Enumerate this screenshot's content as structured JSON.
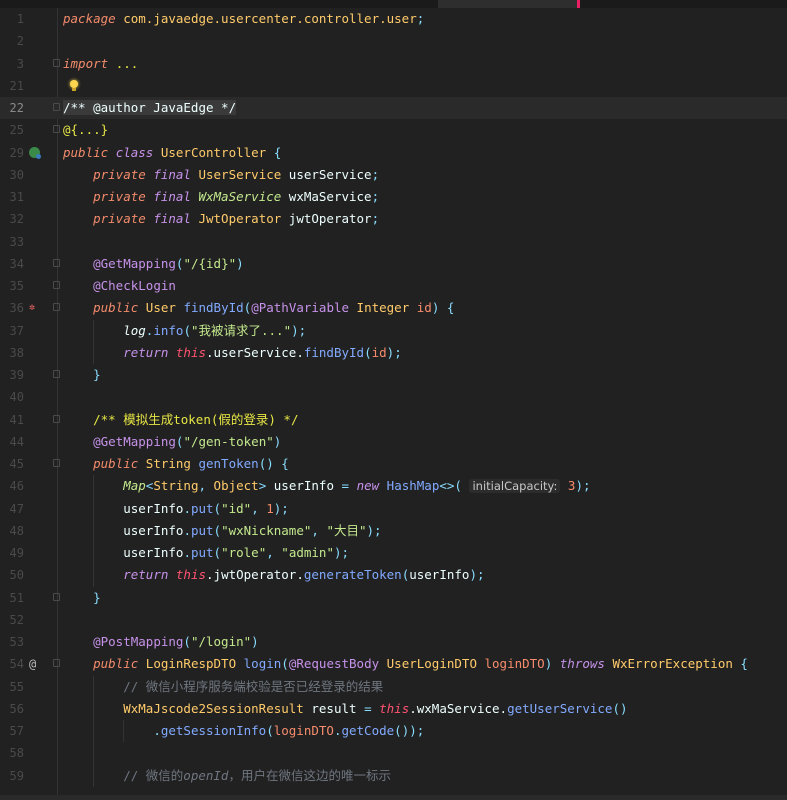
{
  "theme": {
    "background": "#212121",
    "tab_accent": "#e91e63"
  },
  "lines": [
    {
      "n": "1",
      "seg": [
        [
          "package ",
          "kw"
        ],
        [
          "com.javaedge.usercenter.controller.user",
          "ty"
        ],
        [
          ";",
          "pu"
        ]
      ]
    },
    {
      "n": "2",
      "seg": []
    },
    {
      "n": "3",
      "fold": true,
      "seg": [
        [
          "import ",
          "kw"
        ],
        [
          "...",
          "dc"
        ]
      ]
    },
    {
      "n": "21",
      "bulb": true,
      "seg": []
    },
    {
      "n": "22",
      "fold": true,
      "current": true,
      "seg": [
        [
          "/** @author JavaEdge */",
          "dcw"
        ]
      ]
    },
    {
      "n": "25",
      "fold": true,
      "seg": [
        [
          "@{...}",
          "dc"
        ]
      ]
    },
    {
      "n": "29",
      "icon": "class-icon",
      "seg": [
        [
          "public ",
          "kw"
        ],
        [
          "class ",
          "kp"
        ],
        [
          "UserController ",
          "ty"
        ],
        [
          "{",
          "pu"
        ]
      ]
    },
    {
      "n": "30",
      "seg": [
        [
          "    ",
          ""
        ],
        [
          "private ",
          "kw"
        ],
        [
          "final ",
          "kp"
        ],
        [
          "UserService ",
          "ty"
        ],
        [
          "userService",
          "pl"
        ],
        [
          ";",
          "pu"
        ]
      ]
    },
    {
      "n": "31",
      "seg": [
        [
          "    ",
          ""
        ],
        [
          "private ",
          "kw"
        ],
        [
          "final ",
          "kp"
        ],
        [
          "WxMaService ",
          "tyg"
        ],
        [
          "wxMaService",
          "pl"
        ],
        [
          ";",
          "pu"
        ]
      ]
    },
    {
      "n": "32",
      "seg": [
        [
          "    ",
          ""
        ],
        [
          "private ",
          "kw"
        ],
        [
          "final ",
          "kp"
        ],
        [
          "JwtOperator ",
          "ty"
        ],
        [
          "jwtOperator",
          "pl"
        ],
        [
          ";",
          "pu"
        ]
      ]
    },
    {
      "n": "33",
      "seg": []
    },
    {
      "n": "34",
      "fold": true,
      "seg": [
        [
          "    ",
          ""
        ],
        [
          "@GetMapping",
          "an"
        ],
        [
          "(",
          "pu"
        ],
        [
          "\"/{id}\"",
          "st"
        ],
        [
          ")",
          "pu"
        ]
      ]
    },
    {
      "n": "35",
      "fold": true,
      "seg": [
        [
          "    ",
          ""
        ],
        [
          "@CheckLogin",
          "an"
        ]
      ]
    },
    {
      "n": "36",
      "fold": true,
      "icon": "breakpoint-icon",
      "seg": [
        [
          "    ",
          ""
        ],
        [
          "public ",
          "kw"
        ],
        [
          "User ",
          "ty"
        ],
        [
          "findById",
          "fn"
        ],
        [
          "(",
          "pu"
        ],
        [
          "@PathVariable ",
          "an"
        ],
        [
          "Integer ",
          "ty"
        ],
        [
          "id",
          "pa"
        ],
        [
          ") {",
          "pu"
        ]
      ]
    },
    {
      "n": "37",
      "seg": [
        [
          "        ",
          ""
        ],
        [
          "log",
          "it"
        ],
        [
          ".",
          "pu"
        ],
        [
          "info",
          "fn"
        ],
        [
          "(",
          "pu"
        ],
        [
          "\"我被请求了...\"",
          "st"
        ],
        [
          ");",
          "pu"
        ]
      ]
    },
    {
      "n": "38",
      "seg": [
        [
          "        ",
          ""
        ],
        [
          "return ",
          "kp"
        ],
        [
          "this",
          "th"
        ],
        [
          ".userService.",
          "pl"
        ],
        [
          "findById",
          "fn"
        ],
        [
          "(",
          "pu"
        ],
        [
          "id",
          "pa"
        ],
        [
          ");",
          "pu"
        ]
      ]
    },
    {
      "n": "39",
      "fold": true,
      "seg": [
        [
          "    ",
          ""
        ],
        [
          "}",
          "pu"
        ]
      ]
    },
    {
      "n": "40",
      "seg": []
    },
    {
      "n": "41",
      "fold": true,
      "seg": [
        [
          "    ",
          ""
        ],
        [
          "/** 模拟生成token(假的登录) */",
          "dc"
        ]
      ]
    },
    {
      "n": "44",
      "seg": [
        [
          "    ",
          ""
        ],
        [
          "@GetMapping",
          "an"
        ],
        [
          "(",
          "pu"
        ],
        [
          "\"/gen-token\"",
          "st"
        ],
        [
          ")",
          "pu"
        ]
      ]
    },
    {
      "n": "45",
      "fold": true,
      "seg": [
        [
          "    ",
          ""
        ],
        [
          "public ",
          "kw"
        ],
        [
          "String ",
          "ty"
        ],
        [
          "genToken",
          "fn"
        ],
        [
          "() {",
          "pu"
        ]
      ]
    },
    {
      "n": "46",
      "seg": [
        [
          "        ",
          ""
        ],
        [
          "Map",
          "tyg"
        ],
        [
          "<",
          "pu"
        ],
        [
          "String",
          "ty"
        ],
        [
          ", ",
          "pu"
        ],
        [
          "Object",
          "ty"
        ],
        [
          "> ",
          "pu"
        ],
        [
          "userInfo ",
          "pl"
        ],
        [
          "= ",
          "pu"
        ],
        [
          "new ",
          "kp"
        ],
        [
          "HashMap",
          "fn"
        ],
        [
          "<>(",
          "pu"
        ],
        [
          " ",
          ""
        ],
        [
          "initialCapacity:",
          "hint"
        ],
        [
          " ",
          ""
        ],
        [
          "3",
          "nu"
        ],
        [
          ");",
          "pu"
        ]
      ]
    },
    {
      "n": "47",
      "seg": [
        [
          "        ",
          ""
        ],
        [
          "userInfo",
          "pl"
        ],
        [
          ".",
          "pu"
        ],
        [
          "put",
          "fn"
        ],
        [
          "(",
          "pu"
        ],
        [
          "\"id\"",
          "st"
        ],
        [
          ", ",
          "pu"
        ],
        [
          "1",
          "nu"
        ],
        [
          ");",
          "pu"
        ]
      ]
    },
    {
      "n": "48",
      "seg": [
        [
          "        ",
          ""
        ],
        [
          "userInfo",
          "pl"
        ],
        [
          ".",
          "pu"
        ],
        [
          "put",
          "fn"
        ],
        [
          "(",
          "pu"
        ],
        [
          "\"wxNickname\"",
          "st"
        ],
        [
          ", ",
          "pu"
        ],
        [
          "\"大目\"",
          "st"
        ],
        [
          ");",
          "pu"
        ]
      ]
    },
    {
      "n": "49",
      "seg": [
        [
          "        ",
          ""
        ],
        [
          "userInfo",
          "pl"
        ],
        [
          ".",
          "pu"
        ],
        [
          "put",
          "fn"
        ],
        [
          "(",
          "pu"
        ],
        [
          "\"role\"",
          "st"
        ],
        [
          ", ",
          "pu"
        ],
        [
          "\"admin\"",
          "st"
        ],
        [
          ");",
          "pu"
        ]
      ]
    },
    {
      "n": "50",
      "seg": [
        [
          "        ",
          ""
        ],
        [
          "return ",
          "kp"
        ],
        [
          "this",
          "th"
        ],
        [
          ".jwtOperator.",
          "pl"
        ],
        [
          "generateToken",
          "fn"
        ],
        [
          "(",
          "pu"
        ],
        [
          "userInfo",
          "pl"
        ],
        [
          ");",
          "pu"
        ]
      ]
    },
    {
      "n": "51",
      "fold": true,
      "seg": [
        [
          "    ",
          ""
        ],
        [
          "}",
          "pu"
        ]
      ]
    },
    {
      "n": "52",
      "seg": []
    },
    {
      "n": "53",
      "seg": [
        [
          "    ",
          ""
        ],
        [
          "@PostMapping",
          "an"
        ],
        [
          "(",
          "pu"
        ],
        [
          "\"/login\"",
          "st"
        ],
        [
          ")",
          "pu"
        ]
      ]
    },
    {
      "n": "54",
      "fold": true,
      "icon": "at-icon",
      "seg": [
        [
          "    ",
          ""
        ],
        [
          "public ",
          "kw"
        ],
        [
          "LoginRespDTO ",
          "ty"
        ],
        [
          "login",
          "fn"
        ],
        [
          "(",
          "pu"
        ],
        [
          "@RequestBody ",
          "an"
        ],
        [
          "UserLoginDTO ",
          "ty"
        ],
        [
          "loginDTO",
          "pa"
        ],
        [
          ") ",
          "pu"
        ],
        [
          "throws ",
          "kp"
        ],
        [
          "WxErrorException ",
          "ty"
        ],
        [
          "{",
          "pu"
        ]
      ]
    },
    {
      "n": "55",
      "seg": [
        [
          "        ",
          ""
        ],
        [
          "// 微信小程序服务端校验是否已经登录的结果",
          "cm"
        ]
      ]
    },
    {
      "n": "56",
      "seg": [
        [
          "        ",
          ""
        ],
        [
          "WxMaJscode2SessionResult ",
          "ty"
        ],
        [
          "result ",
          "pl"
        ],
        [
          "= ",
          "pu"
        ],
        [
          "this",
          "th"
        ],
        [
          ".wxMaService.",
          "pl"
        ],
        [
          "getUserService",
          "fn"
        ],
        [
          "()",
          "pu"
        ]
      ]
    },
    {
      "n": "57",
      "seg": [
        [
          "            ",
          ""
        ],
        [
          ".",
          "pu"
        ],
        [
          "getSessionInfo",
          "fn"
        ],
        [
          "(",
          "pu"
        ],
        [
          "loginDTO",
          "pa"
        ],
        [
          ".",
          "pu"
        ],
        [
          "getCode",
          "fn"
        ],
        [
          "());",
          "pu"
        ]
      ]
    },
    {
      "n": "58",
      "seg": []
    },
    {
      "n": "59",
      "seg": [
        [
          "        ",
          ""
        ],
        [
          "// 微信的",
          "cm"
        ],
        [
          "openId",
          "cmi"
        ],
        [
          "，用户在微信这边的唯一标示",
          "cm"
        ]
      ]
    }
  ]
}
